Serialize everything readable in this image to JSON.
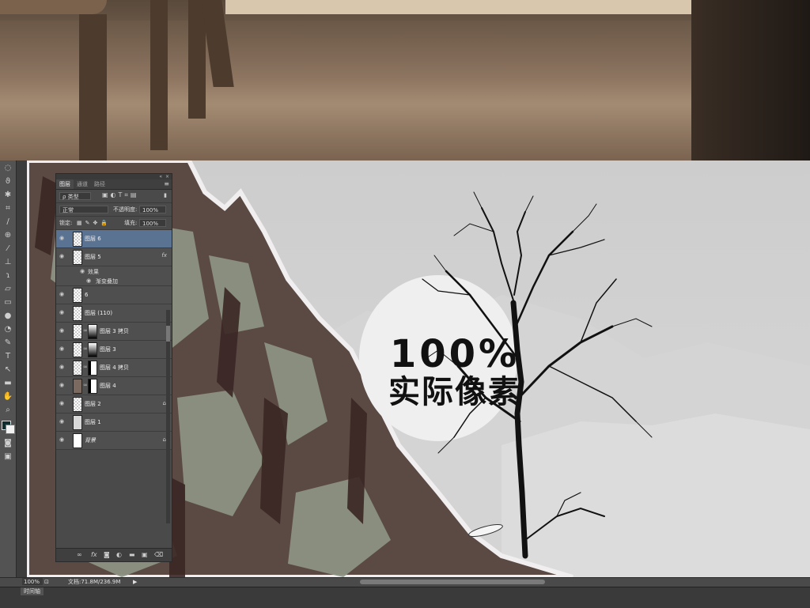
{
  "panel": {
    "tabs": [
      "图层",
      "通道",
      "路径"
    ],
    "filter_label": "ρ 类型",
    "blend_mode": "正常",
    "opacity_label": "不透明度:",
    "opacity_value": "100%",
    "lock_label": "锁定:",
    "fill_label": "填充:",
    "fill_value": "100%",
    "layers": [
      {
        "name": "图层 6",
        "active": true
      },
      {
        "name": "图层 5",
        "fx": "fx"
      },
      {
        "name": "6"
      },
      {
        "name": "图层 (110)"
      },
      {
        "name": "图层 3 拷贝"
      },
      {
        "name": "图层 3"
      },
      {
        "name": "图层 4 拷贝"
      },
      {
        "name": "图层 4"
      },
      {
        "name": "图层 2"
      },
      {
        "name": "图层 1"
      },
      {
        "name": "背景"
      }
    ],
    "effects_label": "效果",
    "gradient_overlay_label": "渐变叠加",
    "fx_label": "fx"
  },
  "statusbar": {
    "zoom": "100%",
    "doc_info": "文档:71.8M/236.9M"
  },
  "timeline_tab": "时间轴",
  "overlay": {
    "line1": "100%",
    "line2": "实际像素"
  },
  "icons": [
    "eye-icon",
    "lock-icon",
    "link-icon",
    "fx-icon",
    "mask-icon",
    "new-layer-icon",
    "trash-icon",
    "folder-icon",
    "adjustment-icon"
  ]
}
